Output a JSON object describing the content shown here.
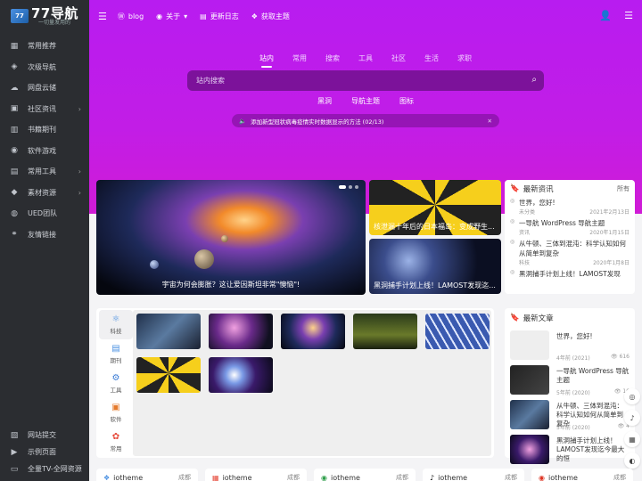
{
  "brand": {
    "name": "77导航",
    "slogan": "一切量发用的",
    "mark": "77"
  },
  "sidebar": {
    "items": [
      {
        "label": "常用推荐",
        "icon": "grid-icon",
        "arrow": false
      },
      {
        "label": "次级导航",
        "icon": "layers-icon",
        "arrow": false
      },
      {
        "label": "网盘云储",
        "icon": "cloud-icon",
        "arrow": false
      },
      {
        "label": "社区资讯",
        "icon": "community-icon",
        "arrow": true
      },
      {
        "label": "书籍期刊",
        "icon": "book-icon",
        "arrow": false
      },
      {
        "label": "软件游戏",
        "icon": "gamepad-icon",
        "arrow": false
      },
      {
        "label": "常用工具",
        "icon": "tools-icon",
        "arrow": true
      },
      {
        "label": "素材资源",
        "icon": "material-icon",
        "arrow": true
      },
      {
        "label": "UED团队",
        "icon": "team-icon",
        "arrow": false
      },
      {
        "label": "友情链接",
        "icon": "link-icon",
        "arrow": false
      }
    ],
    "bottom": [
      {
        "label": "网站提交",
        "icon": "submit-icon"
      },
      {
        "label": "示例页面",
        "icon": "play-icon"
      },
      {
        "label": "全量TV-全网资源",
        "icon": "tv-icon"
      }
    ]
  },
  "topbar": {
    "items": [
      {
        "label": "blog",
        "icon": "wordpress-icon"
      },
      {
        "label": "关于",
        "icon": "info-icon"
      },
      {
        "label": "更新日志",
        "icon": "log-icon"
      },
      {
        "label": "获取主题",
        "icon": "theme-icon"
      }
    ]
  },
  "search": {
    "tabs": [
      "站内",
      "常用",
      "搜索",
      "工具",
      "社区",
      "生活",
      "求职"
    ],
    "active_tab": "站内",
    "placeholder": "站内搜索",
    "quick_links": [
      "黑洞",
      "导航主题",
      "图标"
    ]
  },
  "notice": {
    "text": "添加新型冠状病毒疫情实时数据显示的方法 (02/13)"
  },
  "featured": {
    "caption": "宇宙为何会膨胀？这让爱因斯坦非常\"懊恼\"!"
  },
  "tiles": [
    {
      "caption": "核泄漏十年后的日本福岛：变成野生..."
    },
    {
      "caption": "黑洞捕手计划上线！LAMOST发现迄..."
    }
  ],
  "news": {
    "title": "最新资讯",
    "more": "所有",
    "items": [
      {
        "title": "世界，您好!",
        "cat": "未分类",
        "date": "2021年2月13日"
      },
      {
        "title": "一导航 WordPress 导航主题",
        "cat": "资讯",
        "date": "2020年1月15日"
      },
      {
        "title": "从牛顿、三体到混沌：科学认知如何从简单到复杂",
        "cat": "科技",
        "date": "2020年1月8日"
      },
      {
        "title": "黑洞捕手计划上线！LAMOST发现",
        "cat": "",
        "date": ""
      }
    ]
  },
  "categories": [
    {
      "label": "科技",
      "icon": "⚛"
    },
    {
      "label": "期刊",
      "icon": "▤"
    },
    {
      "label": "工具",
      "icon": "⚙"
    },
    {
      "label": "软件",
      "icon": "▣"
    },
    {
      "label": "常用",
      "icon": "✿"
    }
  ],
  "articles": {
    "title": "最新文章",
    "items": [
      {
        "title": "世界，您好!",
        "time": "4年前 (2021)",
        "views": "616"
      },
      {
        "title": "一导航 WordPress 导航主题",
        "time": "5年前 (2020)",
        "views": "16"
      },
      {
        "title": "从牛顿、三体到混沌：科学认知如何从简单到复杂",
        "time": "5年前 (2020)",
        "views": "4"
      },
      {
        "title": "黑洞捕手计划上线！LAMOST发现迄今最大的恒",
        "time": "",
        "views": ""
      }
    ]
  },
  "bottom_cards": [
    {
      "name": "iotheme",
      "hot": "成都"
    },
    {
      "name": "iotheme",
      "hot": "成都"
    },
    {
      "name": "iotheme",
      "hot": "成都"
    },
    {
      "name": "iotheme",
      "hot": "成都"
    },
    {
      "name": "iotheme",
      "hot": "成都"
    }
  ]
}
